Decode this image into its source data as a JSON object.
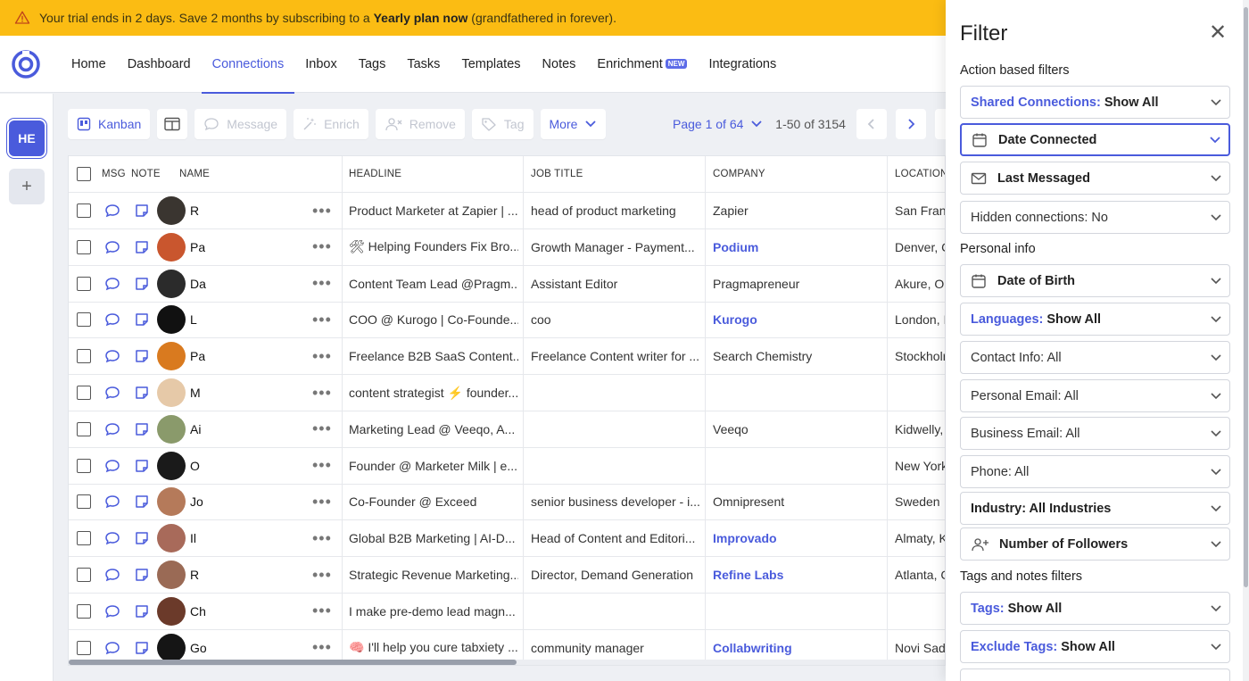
{
  "banner": {
    "pre": "Your trial ends in 2 days. Save 2 months by subscribing to a ",
    "bold": "Yearly plan now",
    "post": " (grandfathered in forever)."
  },
  "nav": {
    "items": [
      {
        "label": "Home"
      },
      {
        "label": "Dashboard"
      },
      {
        "label": "Connections"
      },
      {
        "label": "Inbox"
      },
      {
        "label": "Tags"
      },
      {
        "label": "Tasks"
      },
      {
        "label": "Templates"
      },
      {
        "label": "Notes"
      },
      {
        "label": "Enrichment",
        "badge": "NEW"
      },
      {
        "label": "Integrations"
      }
    ],
    "active": "Connections"
  },
  "sidebar": {
    "workspace": "HE",
    "add": "+"
  },
  "toolbar": {
    "kanban": "Kanban",
    "message": "Message",
    "enrich": "Enrich",
    "remove": "Remove",
    "tag": "Tag",
    "more": "More"
  },
  "pagination": {
    "page": "Page 1 of 64",
    "count": "1-50 of 3154"
  },
  "table": {
    "headers": {
      "msg": "MSG",
      "note": "NOTE",
      "name": "NAME",
      "headline": "HEADLINE",
      "job_title": "JOB TITLE",
      "company": "COMPANY",
      "location": "LOCATION"
    },
    "rows": [
      {
        "name": "R",
        "headline": "Product Marketer at Zapier | ...",
        "job": "head of product marketing",
        "company": "Zapier",
        "company_link": false,
        "location": "San Fran",
        "avatar_color": "#3a3530"
      },
      {
        "name": "Pa",
        "headline": "🛠 Helping Founders Fix Bro...",
        "job": "Growth Manager - Payment...",
        "company": "Podium",
        "company_link": true,
        "location": "Denver, C",
        "avatar_color": "#c9562e"
      },
      {
        "name": "Da",
        "headline": "Content Team Lead @Pragm...",
        "job": "Assistant Editor",
        "company": "Pragmapreneur",
        "company_link": false,
        "location": "Akure, Or",
        "avatar_color": "#2b2b2b"
      },
      {
        "name": "L",
        "headline": "COO @ Kurogo | Co-Founde...",
        "job": "coo",
        "company": "Kurogo",
        "company_link": true,
        "location": "London, I",
        "avatar_color": "#111111"
      },
      {
        "name": "Pa",
        "headline": "Freelance B2B SaaS Content...",
        "job": "Freelance Content writer for ...",
        "company": "Search Chemistry",
        "company_link": false,
        "location": "Stockholr",
        "avatar_color": "#d97a1f"
      },
      {
        "name": "M",
        "headline": "content strategist ⚡ founder...",
        "job": "",
        "company": "",
        "company_link": false,
        "location": "",
        "avatar_color": "#e6c9a8"
      },
      {
        "name": "Ai",
        "headline": "Marketing Lead @ Veeqo, A...",
        "job": "",
        "company": "Veeqo",
        "company_link": false,
        "location": "Kidwelly,",
        "avatar_color": "#8a9a6b"
      },
      {
        "name": "O",
        "headline": "Founder @ Marketer Milk | e...",
        "job": "",
        "company": "",
        "company_link": false,
        "location": "New York",
        "avatar_color": "#1a1a1a"
      },
      {
        "name": "Jo",
        "headline": "Co-Founder @ Exceed",
        "job": "senior business developer - i...",
        "company": "Omnipresent",
        "company_link": false,
        "location": "Sweden",
        "avatar_color": "#b57a5a"
      },
      {
        "name": "Il",
        "headline": "Global B2B Marketing | AI-D...",
        "job": "Head of Content and Editori...",
        "company": "Improvado",
        "company_link": true,
        "location": "Almaty, K",
        "avatar_color": "#a86a5a"
      },
      {
        "name": "R",
        "headline": "Strategic Revenue Marketing...",
        "job": "Director, Demand Generation",
        "company": "Refine Labs",
        "company_link": true,
        "location": "Atlanta, C",
        "avatar_color": "#9a6a55"
      },
      {
        "name": "Ch",
        "headline": "I make pre-demo lead magn...",
        "job": "",
        "company": "",
        "company_link": false,
        "location": "",
        "avatar_color": "#6b3a2a"
      },
      {
        "name": "Go",
        "headline": "🧠 I'll help you cure tabxiety ...",
        "job": "community manager",
        "company": "Collabwriting",
        "company_link": true,
        "location": "Novi Sad",
        "avatar_color": "#151515"
      }
    ]
  },
  "filter": {
    "title": "Filter",
    "close": "✕",
    "sections": {
      "action": "Action based filters",
      "personal": "Personal info",
      "tags": "Tags and notes filters"
    },
    "shared": {
      "label": "Shared Connections:",
      "value": "Show All"
    },
    "date_connected": "Date Connected",
    "last_messaged": "Last Messaged",
    "hidden": "Hidden connections: No",
    "dob": "Date of Birth",
    "languages": {
      "label": "Languages:",
      "value": "Show All"
    },
    "contact": "Contact Info: All",
    "personal_email": "Personal Email: All",
    "business_email": "Business Email: All",
    "phone": "Phone: All",
    "industry": "Industry: All Industries",
    "followers": "Number of Followers",
    "tags": {
      "label": "Tags:",
      "value": "Show All"
    },
    "exclude_tags": {
      "label": "Exclude Tags:",
      "value": "Show All"
    }
  },
  "colors": {
    "accent": "#4a5bdc",
    "banner": "#fbbc13"
  }
}
